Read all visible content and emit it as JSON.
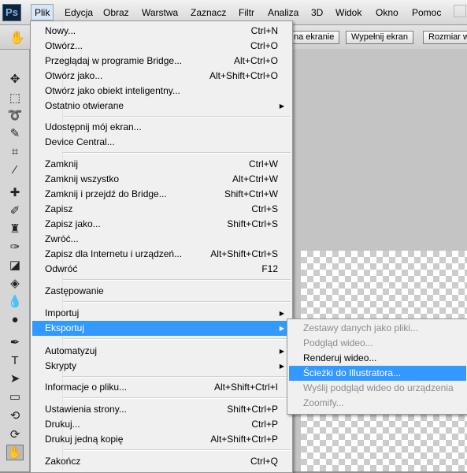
{
  "app_logo": "Ps",
  "menubar": {
    "items": [
      "Plik",
      "Edycja",
      "Obraz",
      "Warstwa",
      "Zaznacz",
      "Filtr",
      "Analiza",
      "3D",
      "Widok",
      "Okno",
      "Pomoc"
    ]
  },
  "optionbar": {
    "buttons": [
      "na ekranie",
      "Wypełnij ekran",
      "Rozmiar w"
    ]
  },
  "file_menu": {
    "items": [
      {
        "label": "Nowy...",
        "shortcut": "Ctrl+N"
      },
      {
        "label": "Otwórz...",
        "shortcut": "Ctrl+O"
      },
      {
        "label": "Przeglądaj w programie Bridge...",
        "shortcut": "Alt+Ctrl+O"
      },
      {
        "label": "Otwórz jako...",
        "shortcut": "Alt+Shift+Ctrl+O"
      },
      {
        "label": "Otwórz jako obiekt inteligentny...",
        "shortcut": ""
      },
      {
        "label": "Ostatnio otwierane",
        "shortcut": ""
      },
      {
        "label": "Udostępnij mój ekran...",
        "shortcut": ""
      },
      {
        "label": "Device Central...",
        "shortcut": ""
      },
      {
        "label": "Zamknij",
        "shortcut": "Ctrl+W"
      },
      {
        "label": "Zamknij wszystko",
        "shortcut": "Alt+Ctrl+W"
      },
      {
        "label": "Zamknij i przejdź do Bridge...",
        "shortcut": "Shift+Ctrl+W"
      },
      {
        "label": "Zapisz",
        "shortcut": "Ctrl+S"
      },
      {
        "label": "Zapisz jako...",
        "shortcut": "Shift+Ctrl+S"
      },
      {
        "label": "Zwróć...",
        "shortcut": ""
      },
      {
        "label": "Zapisz dla Internetu i urządzeń...",
        "shortcut": "Alt+Shift+Ctrl+S"
      },
      {
        "label": "Odwróć",
        "shortcut": "F12"
      },
      {
        "label": "Zastępowanie",
        "shortcut": ""
      },
      {
        "label": "Importuj",
        "shortcut": ""
      },
      {
        "label": "Eksportuj",
        "shortcut": ""
      },
      {
        "label": "Automatyzuj",
        "shortcut": ""
      },
      {
        "label": "Skrypty",
        "shortcut": ""
      },
      {
        "label": "Informacje o pliku...",
        "shortcut": "Alt+Shift+Ctrl+I"
      },
      {
        "label": "Ustawienia strony...",
        "shortcut": "Shift+Ctrl+P"
      },
      {
        "label": "Drukuj...",
        "shortcut": "Ctrl+P"
      },
      {
        "label": "Drukuj jedną kopię",
        "shortcut": "Alt+Shift+Ctrl+P"
      },
      {
        "label": "Zakończ",
        "shortcut": "Ctrl+Q"
      }
    ],
    "submenu_arrow": "▶"
  },
  "export_submenu": {
    "items": [
      {
        "label": "Zestawy danych jako pliki...",
        "state": "disabled"
      },
      {
        "label": "Podgląd wideo...",
        "state": "disabled"
      },
      {
        "label": "Renderuj wideo...",
        "state": "enabled"
      },
      {
        "label": "Ścieżki do Illustratora...",
        "state": "highlighted"
      },
      {
        "label": "Wyślij podgląd wideo do urządzenia",
        "state": "disabled"
      },
      {
        "label": "Zoomify...",
        "state": "disabled"
      }
    ]
  },
  "colors": {
    "highlight": "#3399ff",
    "menu_bg": "#f0f0f0",
    "disabled_text": "#8c8c8c"
  }
}
